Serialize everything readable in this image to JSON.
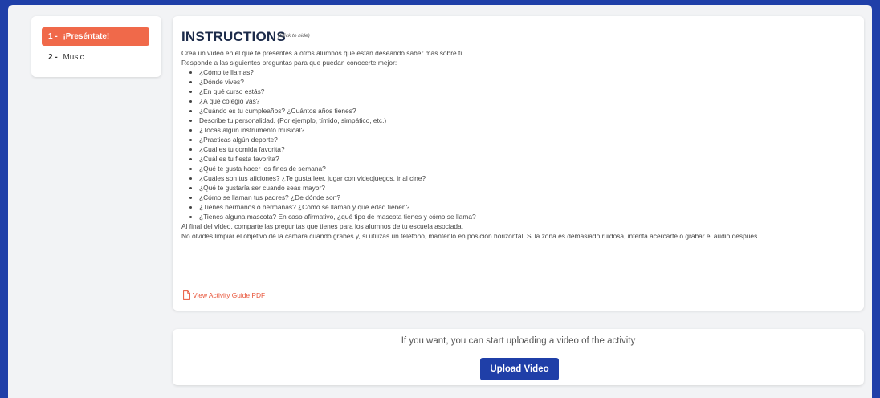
{
  "steps": [
    {
      "number": "1 -",
      "label": "¡Preséntate!",
      "active": true
    },
    {
      "number": "2 -",
      "label": "Music",
      "active": false
    }
  ],
  "instructions": {
    "title": "INSTRUCTIONS",
    "hide_label": "(Click to hide)",
    "intro1": "Crea un vídeo en el que te presentes a otros alumnos que están deseando saber más sobre ti.",
    "intro2": "Responde a las siguientes preguntas para que puedan conocerte mejor:",
    "questions": [
      "¿Cómo te llamas?",
      "¿Dónde vives?",
      "¿En qué curso estás?",
      "¿A qué colegio vas?",
      "¿Cuándo es tu cumpleaños? ¿Cuántos años tienes?",
      "Describe tu personalidad. (Por ejemplo, tímido, simpático, etc.)",
      "¿Tocas algún instrumento musical?",
      "¿Practicas algún deporte?",
      "¿Cuál es tu comida favorita?",
      "¿Cuál es tu fiesta favorita?",
      "¿Qué te gusta hacer los fines de semana?",
      "¿Cuáles son tus aficiones? ¿Te gusta leer, jugar con videojuegos, ir al cine?",
      "¿Qué te gustaría ser cuando seas mayor?",
      "¿Cómo se llaman tus padres? ¿De dónde son?",
      "¿Tienes hermanos o hermanas? ¿Cómo se llaman y qué edad tienen?",
      "¿Tienes alguna mascota? En caso afirmativo, ¿qué tipo de mascota tienes y cómo se llama?"
    ],
    "outro1": "Al final del vídeo, comparte las preguntas que tienes para los alumnos de tu escuela asociada.",
    "outro2": "No olvides limpiar el objetivo de la cámara cuando grabes y, si utilizas un teléfono, mantenlo en posición horizontal. Si la zona es demasiado ruidosa, intenta acercarte o grabar el audio después.",
    "pdf_link": "View Activity Guide PDF"
  },
  "upload": {
    "prompt": "If you want, you can start uploading a video of the activity",
    "button_label": "Upload Video"
  },
  "colors": {
    "brand_blue": "#1f3fa8",
    "accent_orange": "#f0694a"
  }
}
